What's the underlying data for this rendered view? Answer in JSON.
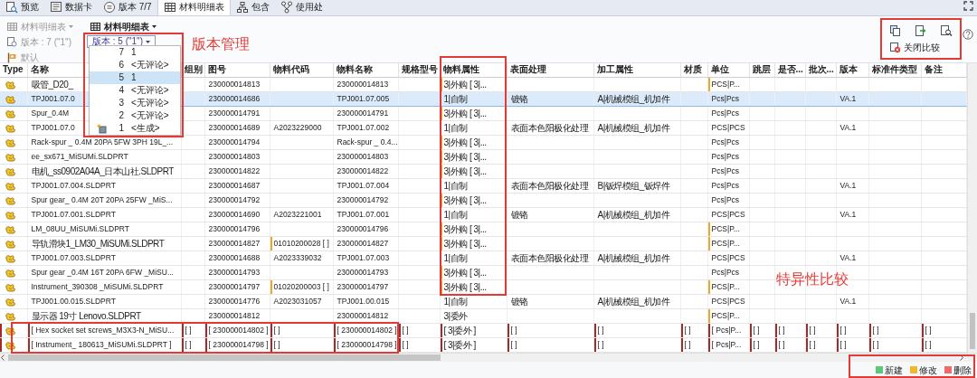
{
  "tabs": [
    {
      "label": "预览",
      "selected": false
    },
    {
      "label": "数据卡",
      "selected": false
    },
    {
      "label": "版本 7/7",
      "selected": false
    },
    {
      "label": "材料明细表",
      "selected": true
    },
    {
      "label": "包含",
      "selected": false
    },
    {
      "label": "使用处",
      "selected": false
    }
  ],
  "toolbar": {
    "bom_menus": [
      {
        "label": "材料明细表",
        "disabled": true
      },
      {
        "label": "材料明细表",
        "disabled": false
      }
    ],
    "current_version": {
      "label": "版本 : 7 (\"1\")",
      "disabled": true
    },
    "version_picker": {
      "label": "版本 : 5 (\"1\")",
      "expanded": true
    },
    "default_view": {
      "label": "默认",
      "disabled": true
    },
    "close_compare": {
      "label": "关闭比较"
    }
  },
  "version_menu": [
    {
      "number": "7",
      "comment": "1",
      "selected": false,
      "kind": "revision"
    },
    {
      "number": "6",
      "comment": "<无评论>",
      "selected": false,
      "kind": "revision"
    },
    {
      "number": "5",
      "comment": "1",
      "selected": true,
      "kind": "revision"
    },
    {
      "number": "4",
      "comment": "<无评论>",
      "selected": false,
      "kind": "revision"
    },
    {
      "number": "3",
      "comment": "<无评论>",
      "selected": false,
      "kind": "revision"
    },
    {
      "number": "2",
      "comment": "<无评论>",
      "selected": false,
      "kind": "revision"
    },
    {
      "number": "1",
      "comment": "<生成>",
      "selected": false,
      "kind": "initial"
    }
  ],
  "table": {
    "columns": [
      "Type",
      "名称",
      "组别",
      "图号",
      "物料代码",
      "物料名称",
      "规格型号",
      "物料属性",
      "表面处理",
      "加工属性",
      "材质",
      "单位",
      "跳层",
      "是否...",
      "批次...",
      "版本",
      "标准件类型",
      "备注"
    ],
    "rows": [
      {
        "selected": false,
        "deleted": false,
        "cells": [
          "",
          {
            "text": "吸管_D20_",
            "changed": false
          },
          null,
          {
            "text": "230000014813",
            "changed": false
          },
          null,
          {
            "text": "230000014813",
            "changed": false
          },
          null,
          {
            "text": "3|外购 [ 3|...",
            "changed": true
          },
          null,
          null,
          null,
          {
            "text": "PCS|P...",
            "changed": true
          }
        ]
      },
      {
        "selected": true,
        "deleted": false,
        "cells": [
          "",
          {
            "text": "TPJ001.07.0",
            "changed": false
          },
          null,
          {
            "text": "230000014686",
            "changed": false
          },
          null,
          {
            "text": "TPJ001.07.005",
            "changed": false
          },
          null,
          {
            "text": "1|自制",
            "changed": false
          },
          {
            "text": "镀铬",
            "changed": false
          },
          {
            "text": "A|机械模组_机加件",
            "changed": false
          },
          null,
          {
            "text": "Pcs|Pcs",
            "changed": false
          },
          null,
          null,
          null,
          {
            "text": "VA.1",
            "changed": false
          }
        ]
      },
      {
        "selected": false,
        "deleted": false,
        "cells": [
          "",
          {
            "text": "Spur_0.4M",
            "changed": false
          },
          null,
          {
            "text": "230000014791",
            "changed": false
          },
          null,
          {
            "text": "230000014791",
            "changed": false
          },
          null,
          {
            "text": "3|外购 [ 3|...",
            "changed": true
          },
          null,
          null,
          null,
          {
            "text": "Pcs|Pcs",
            "changed": false
          }
        ]
      },
      {
        "selected": false,
        "deleted": false,
        "cells": [
          "",
          {
            "text": "TPJ001.07.0",
            "changed": false
          },
          null,
          {
            "text": "230000014689",
            "changed": false
          },
          {
            "text": "A2023229000",
            "changed": false
          },
          {
            "text": "TPJ001.07.002",
            "changed": false
          },
          null,
          {
            "text": "1|自制",
            "changed": false
          },
          {
            "text": "表面本色阳极化处理",
            "changed": false
          },
          {
            "text": "A|机械模组_机加件",
            "changed": false
          },
          null,
          {
            "text": "PCS|PCS",
            "changed": false
          },
          null,
          null,
          null,
          {
            "text": "VA.1",
            "changed": false
          }
        ]
      },
      {
        "selected": false,
        "deleted": false,
        "cells": [
          "",
          {
            "text": "Rack-spur _ 0.4M 20PA 5FW 3PH 19L_...",
            "changed": false
          },
          null,
          {
            "text": "230000014794",
            "changed": false
          },
          null,
          {
            "text": "Rack-spur _ 0.4...",
            "changed": false
          },
          null,
          {
            "text": "3|外购 [ 3|...",
            "changed": true
          },
          null,
          null,
          null,
          {
            "text": "Pcs|Pcs",
            "changed": false
          }
        ]
      },
      {
        "selected": false,
        "deleted": false,
        "cells": [
          "",
          {
            "text": "ee_sx671_MiSUMi.SLDPRT",
            "changed": false
          },
          null,
          {
            "text": "230000014803",
            "changed": false
          },
          null,
          {
            "text": "230000014803",
            "changed": false
          },
          null,
          {
            "text": "3|外购 [ 3|...",
            "changed": true
          },
          null,
          null,
          null,
          {
            "text": "Pcs|Pcs",
            "changed": false
          }
        ]
      },
      {
        "selected": false,
        "deleted": false,
        "cells": [
          "",
          {
            "text": "电机_ss0902A04A_日本山社.SLDPRT",
            "changed": false
          },
          null,
          {
            "text": "230000014822",
            "changed": false
          },
          null,
          {
            "text": "230000014822",
            "changed": false
          },
          null,
          {
            "text": "3|外购 [ 3|...",
            "changed": true
          },
          null,
          null,
          null,
          {
            "text": "Pcs|Pcs",
            "changed": false
          }
        ]
      },
      {
        "selected": false,
        "deleted": false,
        "cells": [
          "",
          {
            "text": "TPJ001.07.004.SLDPRT",
            "changed": false
          },
          null,
          {
            "text": "230000014687",
            "changed": false
          },
          null,
          {
            "text": "TPJ001.07.004",
            "changed": false
          },
          null,
          {
            "text": "1|自制",
            "changed": false
          },
          {
            "text": "表面本色阳极化处理",
            "changed": false
          },
          {
            "text": "B|钣焊模组_钣焊件",
            "changed": false
          },
          null,
          {
            "text": "Pcs|Pcs",
            "changed": false
          },
          null,
          null,
          null,
          {
            "text": "VA.1",
            "changed": false
          }
        ]
      },
      {
        "selected": false,
        "deleted": false,
        "cells": [
          "",
          {
            "text": "Spur gear_ 0.4M 20T 20PA 25FW _MiS...",
            "changed": false
          },
          null,
          {
            "text": "230000014792",
            "changed": false
          },
          null,
          {
            "text": "230000014792",
            "changed": false
          },
          null,
          {
            "text": "3|外购 [ 3|...",
            "changed": true
          },
          null,
          null,
          null,
          {
            "text": "Pcs|Pcs",
            "changed": false
          }
        ]
      },
      {
        "selected": false,
        "deleted": false,
        "cells": [
          "",
          {
            "text": "TPJ001.07.001.SLDPRT",
            "changed": false
          },
          null,
          {
            "text": "230000014690",
            "changed": false
          },
          {
            "text": "A2023221001",
            "changed": false
          },
          {
            "text": "TPJ001.07.001",
            "changed": false
          },
          null,
          {
            "text": "1|自制",
            "changed": false
          },
          {
            "text": "镀铬",
            "changed": false
          },
          {
            "text": "A|机械模组_机加件",
            "changed": false
          },
          null,
          {
            "text": "PCS|PCS",
            "changed": false
          },
          null,
          null,
          null,
          {
            "text": "VA.1",
            "changed": false
          }
        ]
      },
      {
        "selected": false,
        "deleted": false,
        "cells": [
          "",
          {
            "text": "LM_08UU_MiSUMi.SLDPRT",
            "changed": false
          },
          null,
          {
            "text": "230000014796",
            "changed": false
          },
          null,
          {
            "text": "230000014796",
            "changed": false
          },
          null,
          {
            "text": "3|外购 [ 3|...",
            "changed": true
          },
          null,
          null,
          null,
          {
            "text": "PCS|P...",
            "changed": true
          }
        ]
      },
      {
        "selected": false,
        "deleted": false,
        "cells": [
          "",
          {
            "text": "导轨滑块1_LM30_MiSUMi.SLDPRT",
            "changed": false
          },
          null,
          {
            "text": "230000014827",
            "changed": false
          },
          {
            "text": "01010200028 [ ]",
            "changed": true
          },
          {
            "text": "230000014827",
            "changed": false
          },
          null,
          {
            "text": "3|外购 [ 3|...",
            "changed": true
          },
          null,
          null,
          null,
          {
            "text": "PCS|P...",
            "changed": true
          }
        ]
      },
      {
        "selected": false,
        "deleted": false,
        "cells": [
          "",
          {
            "text": "TPJ001.07.003.SLDPRT",
            "changed": false
          },
          null,
          {
            "text": "230000014688",
            "changed": false
          },
          {
            "text": "A2023339032",
            "changed": false
          },
          {
            "text": "TPJ001.07.003",
            "changed": false
          },
          null,
          {
            "text": "1|自制",
            "changed": false
          },
          {
            "text": "表面本色阳极化处理",
            "changed": false
          },
          {
            "text": "A|机械模组_机加件",
            "changed": false
          },
          null,
          {
            "text": "PCS|PCS",
            "changed": false
          },
          null,
          null,
          null,
          {
            "text": "VA.1",
            "changed": false
          }
        ]
      },
      {
        "selected": false,
        "deleted": false,
        "cells": [
          "",
          {
            "text": "Spur gear _0.4M 16T 20PA 6FW _MiSU...",
            "changed": false
          },
          null,
          {
            "text": "230000014793",
            "changed": false
          },
          null,
          {
            "text": "230000014793",
            "changed": false
          },
          null,
          {
            "text": "3|外购 [ 3|...",
            "changed": true
          },
          null,
          null,
          null,
          {
            "text": "Pcs|Pcs",
            "changed": false
          }
        ]
      },
      {
        "selected": false,
        "deleted": false,
        "cells": [
          "",
          {
            "text": "Instrument_390308 _MiSUMi.SLDPRT",
            "changed": false
          },
          null,
          {
            "text": "230000014797",
            "changed": false
          },
          {
            "text": "01020200003 [ ]",
            "changed": true
          },
          {
            "text": "230000014797",
            "changed": false
          },
          null,
          {
            "text": "3|外购 [ 3|...",
            "changed": true
          },
          null,
          null,
          null,
          {
            "text": "PCS|P...",
            "changed": true
          }
        ]
      },
      {
        "selected": false,
        "deleted": false,
        "cells": [
          "",
          {
            "text": "TPJ001.00.015.SLDPRT",
            "changed": false
          },
          null,
          {
            "text": "230000014776",
            "changed": false
          },
          {
            "text": "A2023031057",
            "changed": false
          },
          {
            "text": "TPJ001.00.015",
            "changed": false
          },
          null,
          {
            "text": "1|自制",
            "changed": false
          },
          {
            "text": "镀铬",
            "changed": false
          },
          {
            "text": "A|机械模组_机加件",
            "changed": false
          },
          null,
          {
            "text": "PCS|PCS",
            "changed": false
          },
          null,
          null,
          null,
          {
            "text": "VA.1",
            "changed": false
          }
        ]
      },
      {
        "selected": false,
        "deleted": false,
        "cells": [
          "",
          {
            "text": "显示器 19寸 Lenovo.SLDPRT",
            "changed": false
          },
          null,
          {
            "text": "230000014812",
            "changed": false
          },
          null,
          {
            "text": "230000014812",
            "changed": false
          },
          null,
          {
            "text": "3|委外",
            "changed": false
          },
          null,
          null,
          null,
          {
            "text": "PCS|P...",
            "changed": true
          }
        ]
      },
      {
        "selected": false,
        "deleted": true,
        "cells": [
          "",
          {
            "text": "[ Hex socket set screws_M3X3-N_MiSU..."
          },
          {
            "text": "[ ]"
          },
          {
            "text": "[ 230000014802 ]"
          },
          {
            "text": "[ ]"
          },
          {
            "text": "[ 230000014802 ]"
          },
          {
            "text": "[ ]"
          },
          {
            "text": "[ 3|委外 ]"
          },
          {
            "text": "[ ]"
          },
          {
            "text": "[ ]"
          },
          {
            "text": "[ ]"
          },
          {
            "text": "[ Pcs|P..."
          },
          {
            "text": "[ ]"
          },
          {
            "text": "[ ]"
          },
          {
            "text": "[ ]"
          },
          {
            "text": "[ ]"
          },
          {
            "text": "[ ]"
          },
          {
            "text": "[ ]"
          }
        ]
      },
      {
        "selected": false,
        "deleted": true,
        "cells": [
          "",
          {
            "text": "[ Instrument_ 180613_MiSUMi.SLDPRT ]"
          },
          {
            "text": "[ ]"
          },
          {
            "text": "[ 230000014798 ]"
          },
          {
            "text": "[ ]"
          },
          {
            "text": "[ 230000014798 ]"
          },
          {
            "text": "[ ]"
          },
          {
            "text": "[ 3|委外 ]"
          },
          {
            "text": "[ ]"
          },
          {
            "text": "[ ]"
          },
          {
            "text": "[ ]"
          },
          {
            "text": "[ Pcs|P..."
          },
          {
            "text": "[ ]"
          },
          {
            "text": "[ ]"
          },
          {
            "text": "[ ]"
          },
          {
            "text": "[ ]"
          },
          {
            "text": "[ ]"
          },
          {
            "text": "[ ]"
          }
        ]
      }
    ]
  },
  "legend": [
    {
      "label": "新建",
      "color": "#5cc87a"
    },
    {
      "label": "修改",
      "color": "#f2b630"
    },
    {
      "label": "删除",
      "color": "#ef6b6b"
    }
  ],
  "annotations": [
    {
      "text": "版本管理"
    },
    {
      "text": "特异性比较"
    }
  ]
}
